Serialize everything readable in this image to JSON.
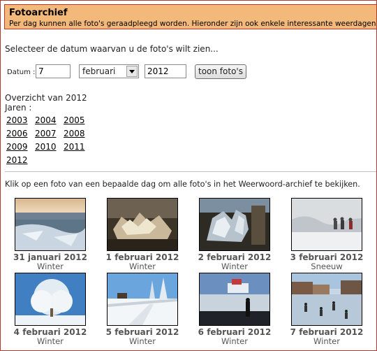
{
  "header": {
    "title": "Fotoarchief",
    "subtitle": "Per dag kunnen alle foto's geraadpleegd worden. Hieronder zijn ook enkele interessante weerdagen opgesom"
  },
  "instruction": "Selecteer de datum waarvan u de foto's wilt zien...",
  "date_form": {
    "label": "Datum :",
    "day": "7",
    "month": "februari",
    "year": "2012",
    "submit_label": "toon foto's"
  },
  "overview": {
    "title": "Overzicht van 2012",
    "years_label": "Jaren :",
    "years": [
      "2003",
      "2004",
      "2005",
      "2006",
      "2007",
      "2008",
      "2009",
      "2010",
      "2011",
      "2012"
    ]
  },
  "click_note": "Klik op een foto van een bepaalde dag om alle foto's in het Weerwoord-archief te bekijken.",
  "photos": [
    {
      "date": "31 januari 2012",
      "category": "Winter",
      "scene": "frozen-beach"
    },
    {
      "date": "1 februari 2012",
      "category": "Winter",
      "scene": "ice-crystals"
    },
    {
      "date": "2 februari 2012",
      "category": "Winter",
      "scene": "ice-sculpture"
    },
    {
      "date": "3 februari 2012",
      "category": "Sneeuw",
      "scene": "snowstorm-walkers"
    },
    {
      "date": "4 februari 2012",
      "category": "Winter",
      "scene": "frosted-tree"
    },
    {
      "date": "5 februari 2012",
      "category": "Winter",
      "scene": "snowy-road"
    },
    {
      "date": "6 februari 2012",
      "category": "Winter",
      "scene": "frozen-harbour"
    },
    {
      "date": "7 februari 2012",
      "category": "Winter",
      "scene": "skaters-canal"
    }
  ]
}
